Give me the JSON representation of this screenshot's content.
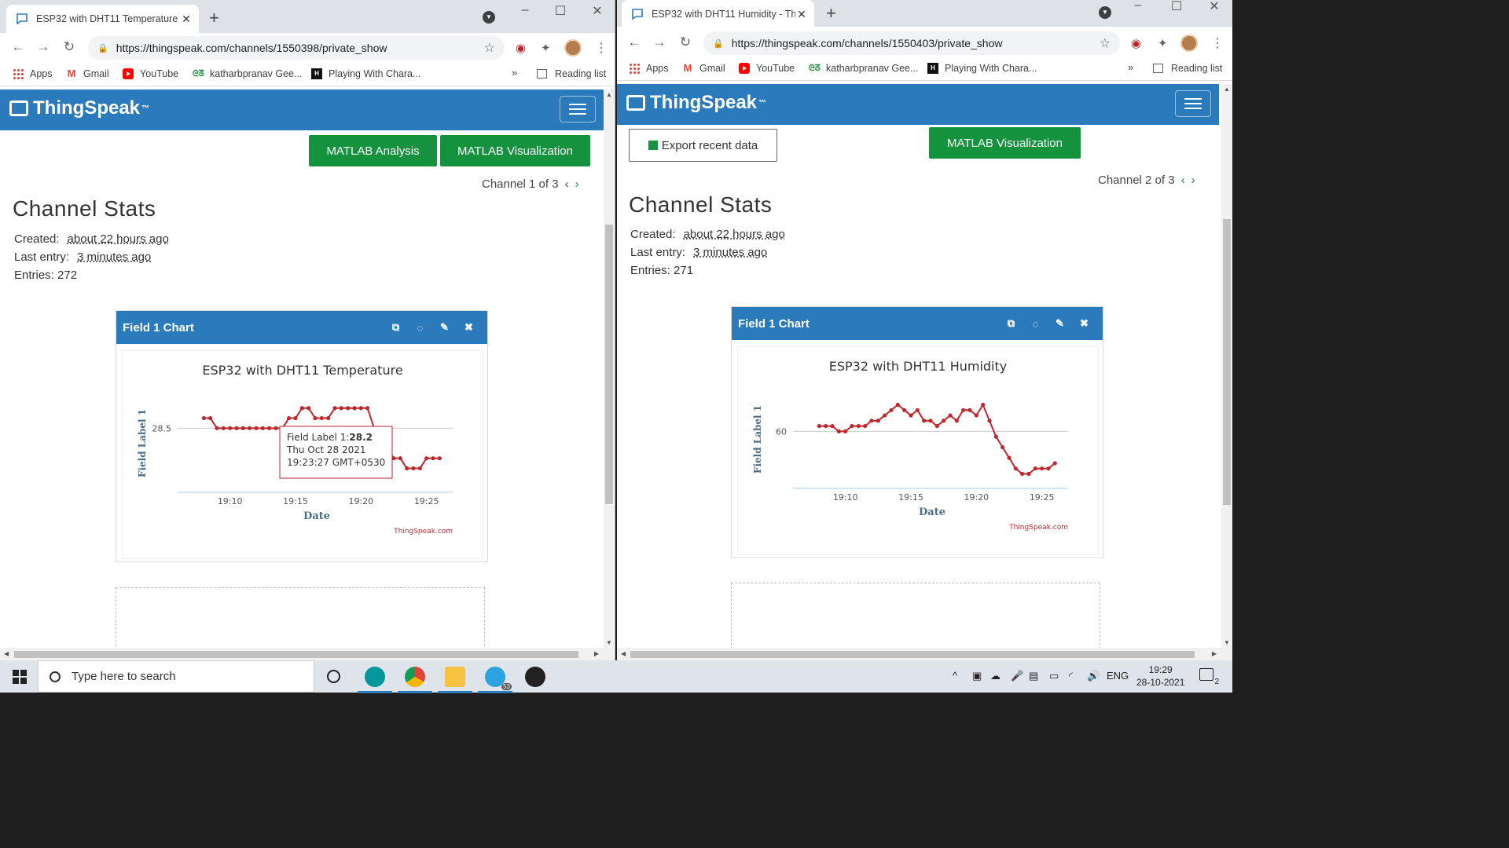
{
  "left": {
    "tab_title": "ESP32 with DHT11 Temperature -",
    "url": "https://thingspeak.com/channels/1550398/private_show",
    "bookmarks": [
      "Apps",
      "Gmail",
      "YouTube",
      "katharbpranav Gee...",
      "Playing With Chara..."
    ],
    "reading_list": "Reading list",
    "more": "»",
    "logo": "ThingSpeak",
    "logo_tm": "™",
    "buttons": [
      "MATLAB Analysis",
      "MATLAB Visualization"
    ],
    "channel_nav": "Channel 1 of 3",
    "stats_heading": "Channel Stats",
    "created_label": "Created:",
    "created_value": "about 22 hours ago",
    "last_entry_label": "Last entry:",
    "last_entry_value": "3 minutes ago",
    "entries": "Entries: 272",
    "widget_title": "Field 1 Chart",
    "tooltip": {
      "label": "Field Label 1:",
      "value": "28.2",
      "date": "Thu Oct 28 2021",
      "time": "19:23:27 GMT+0530"
    }
  },
  "right": {
    "tab_title": "ESP32 with DHT11 Humidity - Th",
    "url": "https://thingspeak.com/channels/1550403/private_show",
    "bookmarks": [
      "Apps",
      "Gmail",
      "YouTube",
      "katharbpranav Gee...",
      "Playing With Chara..."
    ],
    "reading_list": "Reading list",
    "more": "»",
    "logo": "ThingSpeak",
    "logo_tm": "™",
    "export_button": "Export recent data",
    "buttons": [
      "MATLAB Visualization"
    ],
    "channel_nav": "Channel 2 of 3",
    "stats_heading": "Channel Stats",
    "created_label": "Created:",
    "created_value": "about 22 hours ago",
    "last_entry_label": "Last entry:",
    "last_entry_value": "3 minutes ago",
    "entries": "Entries: 271",
    "widget_title": "Field 1 Chart"
  },
  "chart_data": [
    {
      "type": "line",
      "title": "ESP32 with DHT11 Temperature",
      "xlabel": "Date",
      "ylabel": "Field Label 1",
      "y_ticks": [
        28.5
      ],
      "x_ticks": [
        "19:10",
        "19:15",
        "19:20",
        "19:25"
      ],
      "credit": "ThingSpeak.com",
      "color": "#c0272d",
      "x": [
        "19:08",
        "19:08:30",
        "19:09",
        "19:09:30",
        "19:10",
        "19:10:30",
        "19:11",
        "19:11:30",
        "19:12",
        "19:12:30",
        "19:13",
        "19:13:30",
        "19:14",
        "19:14:30",
        "19:15",
        "19:15:30",
        "19:16",
        "19:16:30",
        "19:17",
        "19:17:30",
        "19:18",
        "19:18:30",
        "19:19",
        "19:19:30",
        "19:20",
        "19:20:30",
        "19:21",
        "19:21:30",
        "19:22",
        "19:22:30",
        "19:23",
        "19:23:30",
        "19:24",
        "19:24:30",
        "19:25",
        "19:25:30",
        "19:26"
      ],
      "y": [
        28.6,
        28.6,
        28.5,
        28.5,
        28.5,
        28.5,
        28.5,
        28.5,
        28.5,
        28.5,
        28.5,
        28.5,
        28.5,
        28.6,
        28.6,
        28.7,
        28.7,
        28.6,
        28.6,
        28.6,
        28.7,
        28.7,
        28.7,
        28.7,
        28.7,
        28.7,
        28.5,
        28.4,
        28.3,
        28.2,
        28.2,
        28.1,
        28.1,
        28.1,
        28.2,
        28.2,
        28.2
      ],
      "ylim": [
        27.9,
        28.8
      ]
    },
    {
      "type": "line",
      "title": "ESP32 with DHT11 Humidity",
      "xlabel": "Date",
      "ylabel": "Field Label 1",
      "y_ticks": [
        60
      ],
      "x_ticks": [
        "19:10",
        "19:15",
        "19:20",
        "19:25"
      ],
      "credit": "ThingSpeak.com",
      "color": "#c0272d",
      "x": [
        "19:08",
        "19:08:30",
        "19:09",
        "19:09:30",
        "19:10",
        "19:10:30",
        "19:11",
        "19:11:30",
        "19:12",
        "19:12:30",
        "19:13",
        "19:13:30",
        "19:14",
        "19:14:30",
        "19:15",
        "19:15:30",
        "19:16",
        "19:16:30",
        "19:17",
        "19:17:30",
        "19:18",
        "19:18:30",
        "19:19",
        "19:19:30",
        "19:20",
        "19:20:30",
        "19:21",
        "19:21:30",
        "19:22",
        "19:22:30",
        "19:23",
        "19:23:30",
        "19:24",
        "19:24:30",
        "19:25",
        "19:25:30",
        "19:26"
      ],
      "y": [
        61,
        61,
        61,
        60,
        60,
        61,
        61,
        61,
        62,
        62,
        63,
        64,
        65,
        64,
        63,
        64,
        62,
        62,
        61,
        62,
        63,
        62,
        64,
        64,
        63,
        65,
        62,
        59,
        57,
        55,
        53,
        52,
        52,
        53,
        53,
        53,
        54
      ],
      "ylim": [
        50,
        67
      ]
    }
  ],
  "taskbar": {
    "search_placeholder": "Type here to search",
    "lang": "ENG",
    "time": "19:29",
    "date": "28-10-2021",
    "notifications": "2",
    "badge": "53"
  }
}
